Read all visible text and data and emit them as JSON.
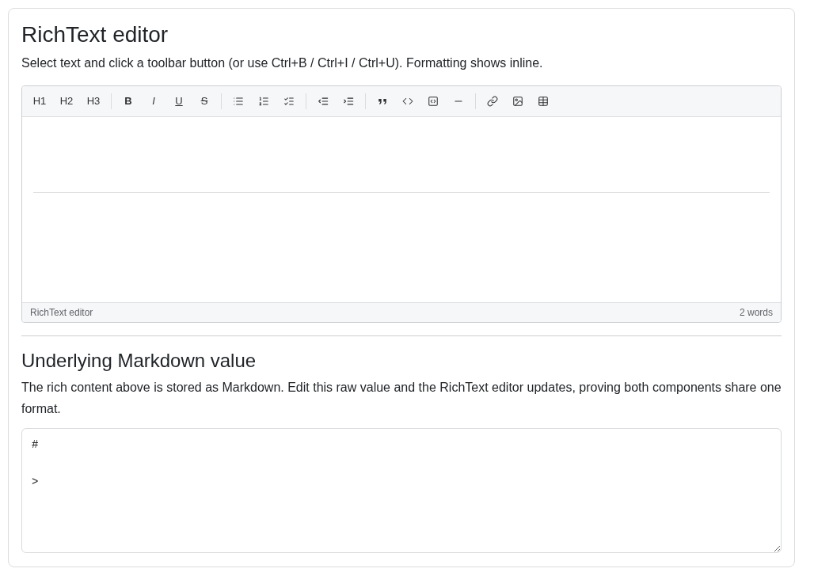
{
  "title": "RichText editor",
  "description": "Select text and click a toolbar button (or use Ctrl+B / Ctrl+I / Ctrl+U). Formatting shows inline.",
  "editor": {
    "heading_buttons": [
      "H1",
      "H2",
      "H3"
    ],
    "format_buttons": [
      {
        "label": "B",
        "kind": "bold"
      },
      {
        "label": "I",
        "kind": "italic"
      },
      {
        "label": "U",
        "kind": "underline"
      },
      {
        "label": "S",
        "kind": "strike"
      }
    ],
    "body": {
      "rule": true
    },
    "status_bar": {
      "label": "RichText editor",
      "word_count": "2 words"
    }
  },
  "markdown": {
    "heading": "Underlying Markdown value",
    "description": "The rich content above is stored as Markdown. Edit this raw value and the RichText editor updates, proving both components share one format.",
    "value": "#\n\n>"
  }
}
